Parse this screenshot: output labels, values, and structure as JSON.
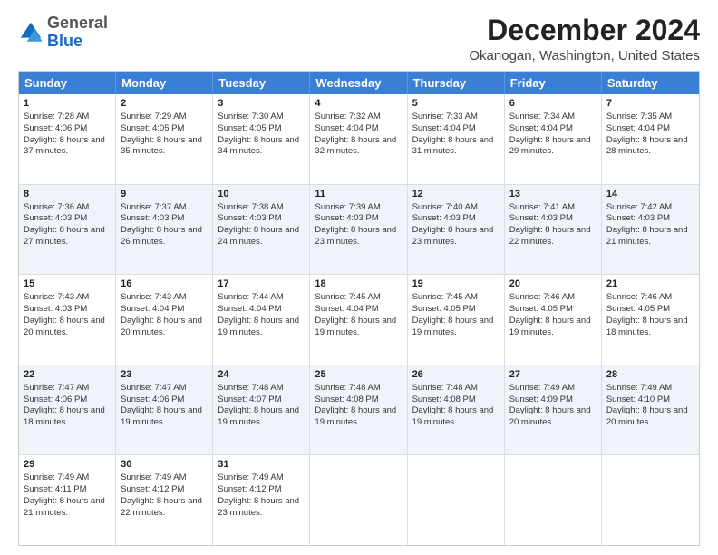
{
  "logo": {
    "general": "General",
    "blue": "Blue"
  },
  "header": {
    "title": "December 2024",
    "subtitle": "Okanogan, Washington, United States"
  },
  "calendar": {
    "days": [
      "Sunday",
      "Monday",
      "Tuesday",
      "Wednesday",
      "Thursday",
      "Friday",
      "Saturday"
    ],
    "rows": [
      [
        {
          "day": "1",
          "sunrise": "Sunrise: 7:28 AM",
          "sunset": "Sunset: 4:06 PM",
          "daylight": "Daylight: 8 hours and 37 minutes."
        },
        {
          "day": "2",
          "sunrise": "Sunrise: 7:29 AM",
          "sunset": "Sunset: 4:05 PM",
          "daylight": "Daylight: 8 hours and 35 minutes."
        },
        {
          "day": "3",
          "sunrise": "Sunrise: 7:30 AM",
          "sunset": "Sunset: 4:05 PM",
          "daylight": "Daylight: 8 hours and 34 minutes."
        },
        {
          "day": "4",
          "sunrise": "Sunrise: 7:32 AM",
          "sunset": "Sunset: 4:04 PM",
          "daylight": "Daylight: 8 hours and 32 minutes."
        },
        {
          "day": "5",
          "sunrise": "Sunrise: 7:33 AM",
          "sunset": "Sunset: 4:04 PM",
          "daylight": "Daylight: 8 hours and 31 minutes."
        },
        {
          "day": "6",
          "sunrise": "Sunrise: 7:34 AM",
          "sunset": "Sunset: 4:04 PM",
          "daylight": "Daylight: 8 hours and 29 minutes."
        },
        {
          "day": "7",
          "sunrise": "Sunrise: 7:35 AM",
          "sunset": "Sunset: 4:04 PM",
          "daylight": "Daylight: 8 hours and 28 minutes."
        }
      ],
      [
        {
          "day": "8",
          "sunrise": "Sunrise: 7:36 AM",
          "sunset": "Sunset: 4:03 PM",
          "daylight": "Daylight: 8 hours and 27 minutes."
        },
        {
          "day": "9",
          "sunrise": "Sunrise: 7:37 AM",
          "sunset": "Sunset: 4:03 PM",
          "daylight": "Daylight: 8 hours and 26 minutes."
        },
        {
          "day": "10",
          "sunrise": "Sunrise: 7:38 AM",
          "sunset": "Sunset: 4:03 PM",
          "daylight": "Daylight: 8 hours and 24 minutes."
        },
        {
          "day": "11",
          "sunrise": "Sunrise: 7:39 AM",
          "sunset": "Sunset: 4:03 PM",
          "daylight": "Daylight: 8 hours and 23 minutes."
        },
        {
          "day": "12",
          "sunrise": "Sunrise: 7:40 AM",
          "sunset": "Sunset: 4:03 PM",
          "daylight": "Daylight: 8 hours and 23 minutes."
        },
        {
          "day": "13",
          "sunrise": "Sunrise: 7:41 AM",
          "sunset": "Sunset: 4:03 PM",
          "daylight": "Daylight: 8 hours and 22 minutes."
        },
        {
          "day": "14",
          "sunrise": "Sunrise: 7:42 AM",
          "sunset": "Sunset: 4:03 PM",
          "daylight": "Daylight: 8 hours and 21 minutes."
        }
      ],
      [
        {
          "day": "15",
          "sunrise": "Sunrise: 7:43 AM",
          "sunset": "Sunset: 4:03 PM",
          "daylight": "Daylight: 8 hours and 20 minutes."
        },
        {
          "day": "16",
          "sunrise": "Sunrise: 7:43 AM",
          "sunset": "Sunset: 4:04 PM",
          "daylight": "Daylight: 8 hours and 20 minutes."
        },
        {
          "day": "17",
          "sunrise": "Sunrise: 7:44 AM",
          "sunset": "Sunset: 4:04 PM",
          "daylight": "Daylight: 8 hours and 19 minutes."
        },
        {
          "day": "18",
          "sunrise": "Sunrise: 7:45 AM",
          "sunset": "Sunset: 4:04 PM",
          "daylight": "Daylight: 8 hours and 19 minutes."
        },
        {
          "day": "19",
          "sunrise": "Sunrise: 7:45 AM",
          "sunset": "Sunset: 4:05 PM",
          "daylight": "Daylight: 8 hours and 19 minutes."
        },
        {
          "day": "20",
          "sunrise": "Sunrise: 7:46 AM",
          "sunset": "Sunset: 4:05 PM",
          "daylight": "Daylight: 8 hours and 19 minutes."
        },
        {
          "day": "21",
          "sunrise": "Sunrise: 7:46 AM",
          "sunset": "Sunset: 4:05 PM",
          "daylight": "Daylight: 8 hours and 18 minutes."
        }
      ],
      [
        {
          "day": "22",
          "sunrise": "Sunrise: 7:47 AM",
          "sunset": "Sunset: 4:06 PM",
          "daylight": "Daylight: 8 hours and 18 minutes."
        },
        {
          "day": "23",
          "sunrise": "Sunrise: 7:47 AM",
          "sunset": "Sunset: 4:06 PM",
          "daylight": "Daylight: 8 hours and 19 minutes."
        },
        {
          "day": "24",
          "sunrise": "Sunrise: 7:48 AM",
          "sunset": "Sunset: 4:07 PM",
          "daylight": "Daylight: 8 hours and 19 minutes."
        },
        {
          "day": "25",
          "sunrise": "Sunrise: 7:48 AM",
          "sunset": "Sunset: 4:08 PM",
          "daylight": "Daylight: 8 hours and 19 minutes."
        },
        {
          "day": "26",
          "sunrise": "Sunrise: 7:48 AM",
          "sunset": "Sunset: 4:08 PM",
          "daylight": "Daylight: 8 hours and 19 minutes."
        },
        {
          "day": "27",
          "sunrise": "Sunrise: 7:49 AM",
          "sunset": "Sunset: 4:09 PM",
          "daylight": "Daylight: 8 hours and 20 minutes."
        },
        {
          "day": "28",
          "sunrise": "Sunrise: 7:49 AM",
          "sunset": "Sunset: 4:10 PM",
          "daylight": "Daylight: 8 hours and 20 minutes."
        }
      ],
      [
        {
          "day": "29",
          "sunrise": "Sunrise: 7:49 AM",
          "sunset": "Sunset: 4:11 PM",
          "daylight": "Daylight: 8 hours and 21 minutes."
        },
        {
          "day": "30",
          "sunrise": "Sunrise: 7:49 AM",
          "sunset": "Sunset: 4:12 PM",
          "daylight": "Daylight: 8 hours and 22 minutes."
        },
        {
          "day": "31",
          "sunrise": "Sunrise: 7:49 AM",
          "sunset": "Sunset: 4:12 PM",
          "daylight": "Daylight: 8 hours and 23 minutes."
        },
        null,
        null,
        null,
        null
      ]
    ]
  }
}
